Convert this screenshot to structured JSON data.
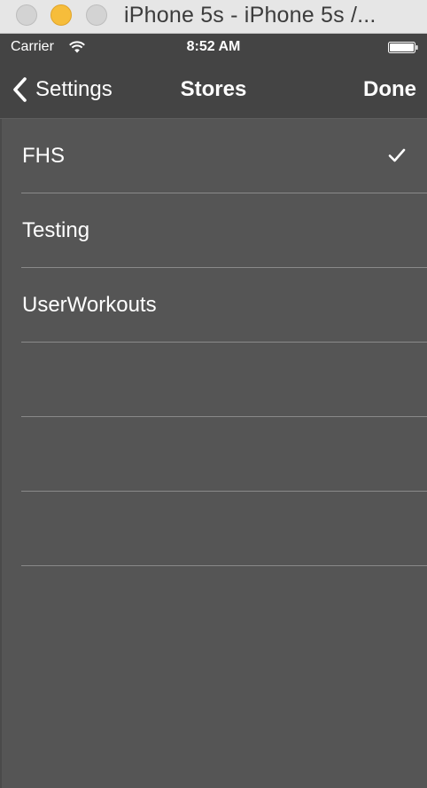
{
  "window": {
    "title": "iPhone 5s - iPhone 5s /..."
  },
  "status_bar": {
    "carrier": "Carrier",
    "time": "8:52 AM",
    "icons": [
      "wifi-icon",
      "battery-icon"
    ]
  },
  "nav_bar": {
    "back_label": "Settings",
    "title": "Stores",
    "done_label": "Done"
  },
  "table": {
    "rows": [
      {
        "label": "FHS",
        "selected": true
      },
      {
        "label": "Testing",
        "selected": false
      },
      {
        "label": "UserWorkouts",
        "selected": false
      },
      {
        "label": "",
        "selected": false
      },
      {
        "label": "",
        "selected": false
      },
      {
        "label": "",
        "selected": false
      }
    ]
  },
  "colors": {
    "background": "#555555",
    "bar": "#444444",
    "separator": "#8a8a8a",
    "text": "#ffffff"
  }
}
